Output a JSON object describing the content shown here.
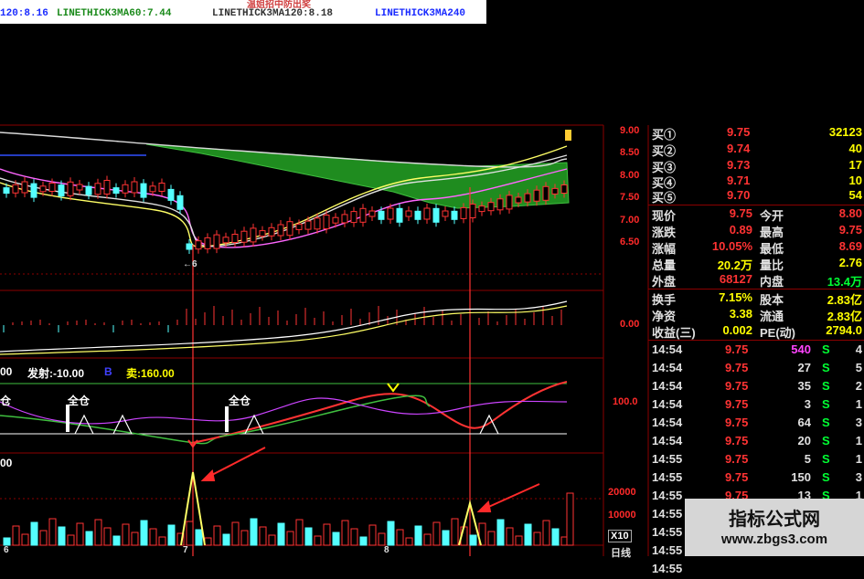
{
  "legend": {
    "ma1": "120:8.16",
    "ma2": "LINETHICK3MA60:7.44",
    "ma3": "LINETHICK3MA120:8.18",
    "ma4": "LINETHICK3MA240",
    "title_frag": "温姐招中防出奖"
  },
  "price_axis": [
    "9.00",
    "8.50",
    "8.00",
    "7.50",
    "7.00",
    "6.50"
  ],
  "low_marker": "6",
  "macd_axis": "0.00",
  "signal_panel": {
    "line1": "00",
    "fire": "发射:-10.00",
    "b": "B",
    "sell": "卖:160.00",
    "tag1": "仓",
    "tag2": "全仓",
    "tag3": "全仓",
    "axis": "100.0"
  },
  "vol_panel": {
    "line1": "00",
    "ax1": "20000",
    "ax2": "10000",
    "ax3": "X10"
  },
  "dates": [
    "6",
    "7",
    "8"
  ],
  "period": "日线",
  "quote_rows": [
    {
      "label": "买①",
      "price": "9.75",
      "qty": "32123"
    },
    {
      "label": "买②",
      "price": "9.74",
      "qty": "40"
    },
    {
      "label": "买③",
      "price": "9.73",
      "qty": "17"
    },
    {
      "label": "买④",
      "price": "9.71",
      "qty": "10"
    },
    {
      "label": "买⑤",
      "price": "9.70",
      "qty": "54"
    }
  ],
  "stats": [
    {
      "l1": "现价",
      "v1": "9.75",
      "l2": "今开",
      "v2": "8.80"
    },
    {
      "l1": "涨跌",
      "v1": "0.89",
      "l2": "最高",
      "v2": "9.75"
    },
    {
      "l1": "涨幅",
      "v1": "10.05%",
      "l2": "最低",
      "v2": "8.69"
    },
    {
      "l1": "总量",
      "v1": "20.2万",
      "l2": "量比",
      "v2": "2.76"
    },
    {
      "l1": "外盘",
      "v1": "68127",
      "l2": "内盘",
      "v2": "13.4万"
    },
    {
      "l1": "换手",
      "v1": "7.15%",
      "l2": "股本",
      "v2": "2.83亿"
    },
    {
      "l1": "净资",
      "v1": "3.38",
      "l2": "流通",
      "v2": "2.83亿"
    },
    {
      "l1": "收益(三)",
      "v1": "0.002",
      "l2": "PE(动)",
      "v2": "2794.0"
    }
  ],
  "ticks": [
    {
      "t": "14:54",
      "p": "9.75",
      "v": "540",
      "s": "S",
      "n": "4"
    },
    {
      "t": "14:54",
      "p": "9.75",
      "v": "27",
      "s": "S",
      "n": "5"
    },
    {
      "t": "14:54",
      "p": "9.75",
      "v": "35",
      "s": "S",
      "n": "2"
    },
    {
      "t": "14:54",
      "p": "9.75",
      "v": "3",
      "s": "S",
      "n": "1"
    },
    {
      "t": "14:54",
      "p": "9.75",
      "v": "64",
      "s": "S",
      "n": "3"
    },
    {
      "t": "14:54",
      "p": "9.75",
      "v": "20",
      "s": "S",
      "n": "1"
    },
    {
      "t": "14:55",
      "p": "9.75",
      "v": "5",
      "s": "S",
      "n": "1"
    },
    {
      "t": "14:55",
      "p": "9.75",
      "v": "150",
      "s": "S",
      "n": "3"
    },
    {
      "t": "14:55",
      "p": "9.75",
      "v": "13",
      "s": "S",
      "n": "1"
    },
    {
      "t": "14:55",
      "p": "9.75",
      "v": "80",
      "s": "S",
      "n": "1"
    },
    {
      "t": "14:55",
      "p": "9.75",
      "v": "5",
      "s": "S",
      "n": "1"
    },
    {
      "t": "14:55",
      "p": "9.75",
      "v": "25",
      "s": "S",
      "n": "1"
    },
    {
      "t": "14:55",
      "p": "",
      "v": "",
      "s": "",
      "n": ""
    }
  ],
  "watermark": {
    "line1": "指标公式网",
    "line2": "www.zbgs3.com"
  },
  "colors": {
    "up": "#ff3333",
    "down": "#54ffff",
    "bg": "#000000",
    "grid": "#8b0000",
    "yellow": "#ffff00",
    "green": "#1f8c1f"
  }
}
